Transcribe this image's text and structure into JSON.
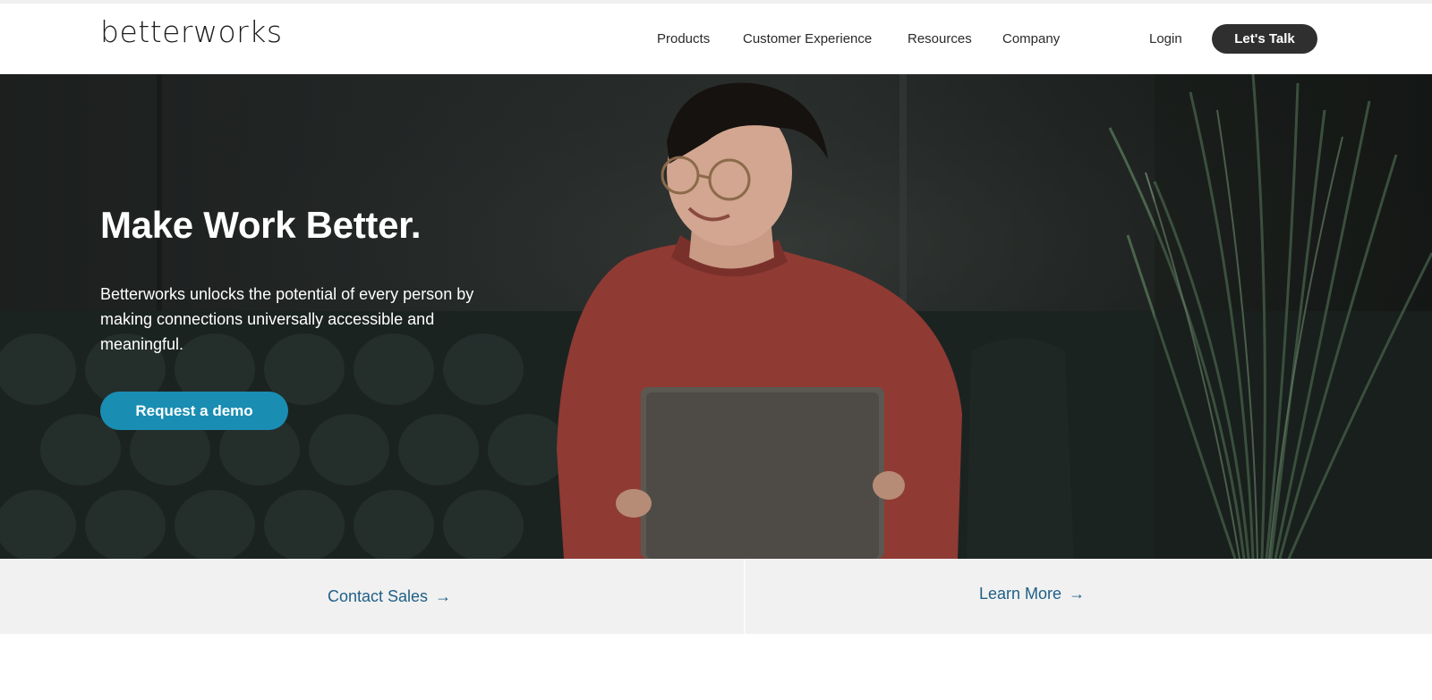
{
  "header": {
    "logo": "betterworks",
    "nav": {
      "products": "Products",
      "customer_experience": "Customer Experience",
      "resources": "Resources",
      "company": "Company"
    },
    "login": "Login",
    "cta": "Let's Talk"
  },
  "hero": {
    "title": "Make Work Better.",
    "description": "Betterworks unlocks the potential of every person by making connections universally accessible and meaningful.",
    "button": "Request a demo",
    "image_icon": "photo-person-with-laptop"
  },
  "links": {
    "contact_sales": "Contact Sales",
    "learn_more": "Learn More",
    "arrow_icon": "arrow-right-icon"
  },
  "colors": {
    "accent": "#1a8db3",
    "link": "#1f5f86",
    "dark_button": "#2f2f2f"
  }
}
